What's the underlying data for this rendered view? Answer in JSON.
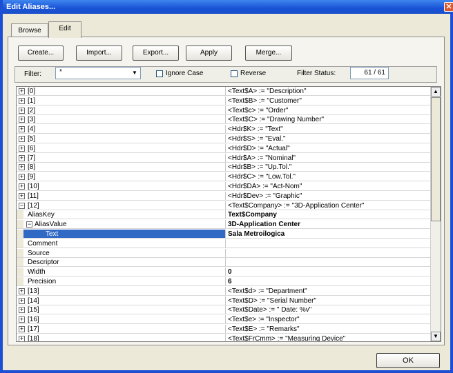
{
  "window": {
    "title": "Edit Aliases...",
    "close_glyph": "✕"
  },
  "tabs": [
    {
      "label": "Browse"
    },
    {
      "label": "Edit"
    }
  ],
  "toolbar": {
    "create": "Create...",
    "import": "Import...",
    "export": "Export...",
    "apply": "Apply",
    "merge": "Merge..."
  },
  "filter": {
    "label": "Filter:",
    "value": "*",
    "dropdown_glyph": "▼",
    "ignore_case": "Ignore Case",
    "reverse": "Reverse",
    "status_label": "Filter Status:",
    "status_value": "61 / 61"
  },
  "rows": [
    {
      "label": "[0]",
      "value": "<Text$A> := \"Description\"",
      "level": 0,
      "expander": "+"
    },
    {
      "label": "[1]",
      "value": "<Text$B> := \"Customer\"",
      "level": 0,
      "expander": "+"
    },
    {
      "label": "[2]",
      "value": "<Text$c> := \"Order\"",
      "level": 0,
      "expander": "+"
    },
    {
      "label": "[3]",
      "value": "<Text$C> := \"Drawing Number\"",
      "level": 0,
      "expander": "+"
    },
    {
      "label": "[4]",
      "value": "<Hdr$K> := \"Text\"",
      "level": 0,
      "expander": "+"
    },
    {
      "label": "[5]",
      "value": "<Hdr$S> := \"Eval.\"",
      "level": 0,
      "expander": "+"
    },
    {
      "label": "[6]",
      "value": "<Hdr$D> := \"Actual\"",
      "level": 0,
      "expander": "+"
    },
    {
      "label": "[7]",
      "value": "<Hdr$A> := \"Nominal\"",
      "level": 0,
      "expander": "+"
    },
    {
      "label": "[8]",
      "value": "<Hdr$B> := \"Up.Tol.\"",
      "level": 0,
      "expander": "+"
    },
    {
      "label": "[9]",
      "value": "<Hdr$C> := \"Low.Tol.\"",
      "level": 0,
      "expander": "+"
    },
    {
      "label": "[10]",
      "value": "<Hdr$DA> := \"Act-Nom\"",
      "level": 0,
      "expander": "+"
    },
    {
      "label": "[11]",
      "value": "<Hdr$Dev> := \"Graphic\"",
      "level": 0,
      "expander": "+"
    },
    {
      "label": "[12]",
      "value": "<Text$Company> := \"3D-Application Center\"",
      "level": 0,
      "expander": "−"
    },
    {
      "label": "AliasKey",
      "value": "Text$Company",
      "level": 1,
      "expander": "",
      "bold": true
    },
    {
      "label": "AliasValue",
      "value": "3D-Application Center",
      "level": 1,
      "expander": "−",
      "bold": true
    },
    {
      "label": "Text",
      "value": "Sala Metroilogica",
      "level": 2,
      "expander": "",
      "bold": true,
      "selected": true
    },
    {
      "label": "Comment",
      "value": "",
      "level": 1,
      "expander": ""
    },
    {
      "label": "Source",
      "value": "",
      "level": 1,
      "expander": ""
    },
    {
      "label": "Descriptor",
      "value": "",
      "level": 1,
      "expander": ""
    },
    {
      "label": "Width",
      "value": "0",
      "level": 1,
      "expander": "",
      "bold": true
    },
    {
      "label": "Precision",
      "value": "6",
      "level": 1,
      "expander": "",
      "bold": true
    },
    {
      "label": "[13]",
      "value": "<Text$d> := \"Department\"",
      "level": 0,
      "expander": "+"
    },
    {
      "label": "[14]",
      "value": "<Text$D> := \"Serial Number\"",
      "level": 0,
      "expander": "+"
    },
    {
      "label": "[15]",
      "value": "<Text$Date> := \" Date: %v\"",
      "level": 0,
      "expander": "+"
    },
    {
      "label": "[16]",
      "value": "<Text$e> := \"Inspector\"",
      "level": 0,
      "expander": "+"
    },
    {
      "label": "[17]",
      "value": "<Text$E> := \"Remarks\"",
      "level": 0,
      "expander": "+"
    },
    {
      "label": "[18]",
      "value": "<Text$FrCmm> := \"Measuring Device\"",
      "level": 0,
      "expander": "+"
    }
  ],
  "scroll": {
    "up_glyph": "▲",
    "down_glyph": "▼"
  },
  "ok_label": "OK"
}
